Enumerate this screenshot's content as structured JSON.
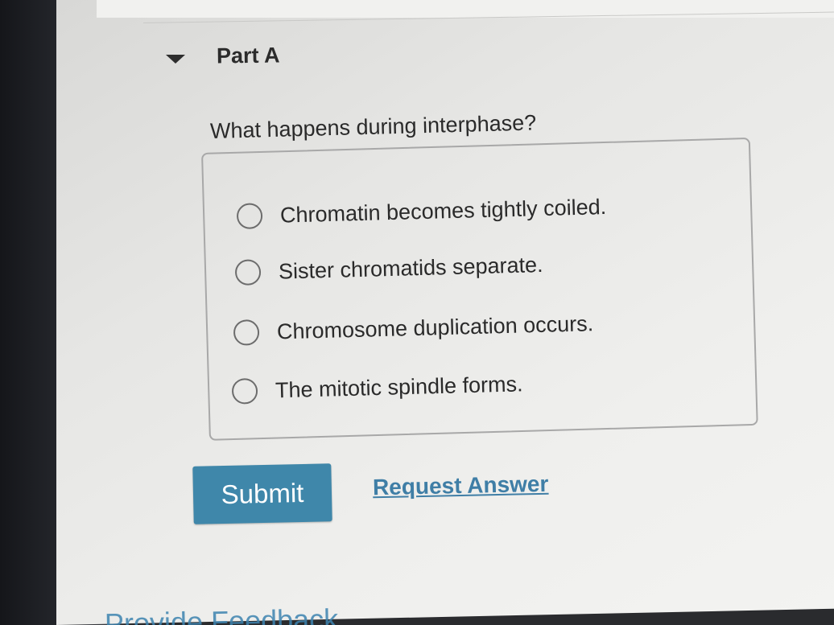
{
  "part": {
    "title": "Part A"
  },
  "question": {
    "text": "What happens during interphase?"
  },
  "options": [
    {
      "label": "Chromatin becomes tightly coiled.",
      "selected": false
    },
    {
      "label": "Sister chromatids separate.",
      "selected": false
    },
    {
      "label": "Chromosome duplication occurs.",
      "selected": false
    },
    {
      "label": "The mitotic spindle forms.",
      "selected": false
    }
  ],
  "actions": {
    "submit_label": "Submit",
    "request_answer_label": "Request Answer"
  },
  "footer": {
    "feedback_label": "Provide Feedback"
  },
  "colors": {
    "accent": "#3f87aa",
    "link": "#3f7ea6"
  },
  "icons": {
    "collapse": "caret-down-icon",
    "radio": "radio-unchecked-icon"
  }
}
